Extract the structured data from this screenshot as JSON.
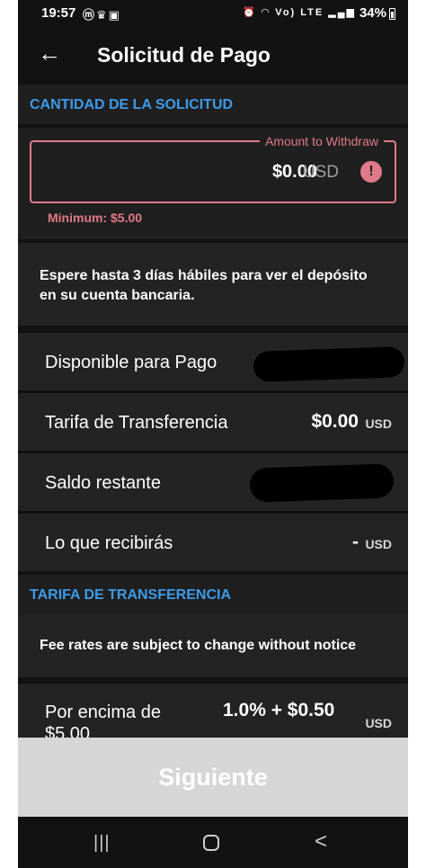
{
  "status_bar": {
    "time": "19:57",
    "left_icons": [
      "messenger-icon",
      "crown-icon",
      "shopping-bag-icon"
    ],
    "network": "Vo) LTE",
    "battery": "34%"
  },
  "header": {
    "back_icon": "arrow-left-icon",
    "title": "Solicitud de Pago"
  },
  "amount_section": {
    "title": "CANTIDAD DE LA SOLICITUD",
    "field_label": "Amount to Withdraw",
    "value": "$0.00",
    "currency": "USD",
    "alert_icon": "!",
    "minimum": "Minimum: $5.00",
    "error_color": "#e07a88"
  },
  "info": {
    "text": "Espere hasta 3 días hábiles para ver el depósito en su cuenta bancaria."
  },
  "rows": [
    {
      "label": "Disponible para Pago"
    },
    {
      "label": "Tarifa de Transferencia",
      "value": "$0.00",
      "currency": "USD"
    },
    {
      "label": "Saldo restante"
    },
    {
      "label": "Lo que recibirás",
      "value": "-",
      "currency": "USD"
    }
  ],
  "fee_section": {
    "title": "TARIFA DE TRANSFERENCIA",
    "note": "Fee rates are subject to change without notice",
    "row_label": "Por encima de $5.00",
    "row_value": "1.0% + $0.50",
    "row_currency": "USD"
  },
  "next_button": {
    "label": "Siguiente"
  },
  "nav_bar": {
    "recent": "|||",
    "back": "<"
  },
  "colors": {
    "accent_blue": "#3d9be9",
    "error_pink": "#e07a88",
    "background": "#121212"
  }
}
